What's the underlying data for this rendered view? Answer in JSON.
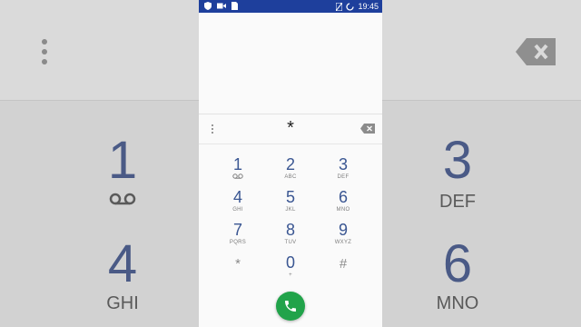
{
  "status_bar": {
    "time": "19:45"
  },
  "dial_input": {
    "value": "*"
  },
  "keys": [
    {
      "digit": "1",
      "letters": ""
    },
    {
      "digit": "2",
      "letters": "ABC"
    },
    {
      "digit": "3",
      "letters": "DEF"
    },
    {
      "digit": "4",
      "letters": "GHI"
    },
    {
      "digit": "5",
      "letters": "JKL"
    },
    {
      "digit": "6",
      "letters": "MNO"
    },
    {
      "digit": "7",
      "letters": "PQRS"
    },
    {
      "digit": "8",
      "letters": "TUV"
    },
    {
      "digit": "9",
      "letters": "WXYZ"
    },
    {
      "digit": "*",
      "letters": ""
    },
    {
      "digit": "0",
      "letters": "+"
    },
    {
      "digit": "#",
      "letters": ""
    }
  ],
  "icons": {
    "status": [
      "shield-icon",
      "video-icon",
      "sim-card-icon",
      "no-sim-icon",
      "loading-icon"
    ],
    "voicemail": "voicemail-icon",
    "backspace": "backspace-icon",
    "call": "phone-icon",
    "menu": "more-vert-icon"
  },
  "colors": {
    "status_bar": "#1e3f9c",
    "digit": "#3a5692",
    "call_button": "#21a34a"
  }
}
